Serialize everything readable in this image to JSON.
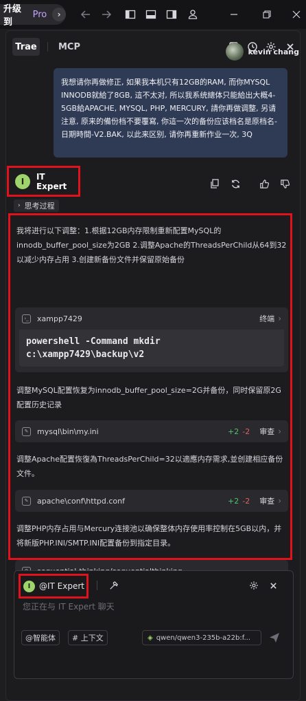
{
  "topbar": {
    "upgrade_label": "升级到",
    "pro_label": "Pro"
  },
  "header": {
    "tabs": [
      {
        "label": "Trae",
        "active": true
      },
      {
        "label": "MCP",
        "active": false
      }
    ]
  },
  "user": {
    "name": "kevin chang",
    "message": "我想请你再做修正, 如果我本机只有12GB的RAM, 而你MYSQL INNODB就給了8GB, 這不太对, 所以我系统總体只能給出大概4-5GB給APACHE, MYSQL, PHP, MERCURY, 請你再做调整, 另请注意, 原来的備份档不要覆寫, 你這一次的备份应该档名是原档名-日期時間-V2.BAK, 以此来区别, 请你再重新作业一次, 3Q"
  },
  "ai": {
    "avatar_letter": "I",
    "name": "IT Expert",
    "thinking_label": "思考过程",
    "intro": "我将进行以下调整：1.根据12GB内存限制重新配置MySQL的innodb_buffer_pool_size为2GB 2.调整Apache的ThreadsPerChild从64到32以减少内存占用 3.创建新备份文件并保留原始备份",
    "terminal_card": {
      "name": "xampp7429",
      "action": "终端",
      "command": "powershell -Command mkdir c:\\xampp7429\\backup\\v2"
    },
    "para2": "调整MySQL配置恢复为innodb_buffer_pool_size=2G并备份，同时保留原2G配置历史记录",
    "file1": {
      "path": "mysql\\bin\\my.ini",
      "added": "+2",
      "removed": "-2",
      "action": "审查"
    },
    "para3": "调整Apache配置恢復為ThreadsPerChild=32以適應内存需求,並创建相应备份文件。",
    "file2": {
      "path": "apache\\conf\\httpd.conf",
      "added": "+2",
      "removed": "-2",
      "action": "审查"
    },
    "para4": "调整PHP内存占用与Mercury连接池以确保整体内存使用率控制在5GB以内，并将新版PHP.INI/SMTP.INI配置备份到指定目录。",
    "tool": {
      "name": "sequential-thinking/sequentialthinking"
    }
  },
  "input": {
    "mention_label": "@IT Expert",
    "placeholder": "您正在与 IT Expert 聊天",
    "agent_chip": "@智能体",
    "context_chip": "# 上下文",
    "model": "qwen/qwen3-235b-a22b:f..."
  },
  "colors": {
    "highlight": "#e0121b",
    "user_bubble": "#2f3b55",
    "ai_avatar": "#9fd36b",
    "added": "#4fc36c",
    "removed": "#e06060",
    "pro": "#c7a2ff"
  }
}
